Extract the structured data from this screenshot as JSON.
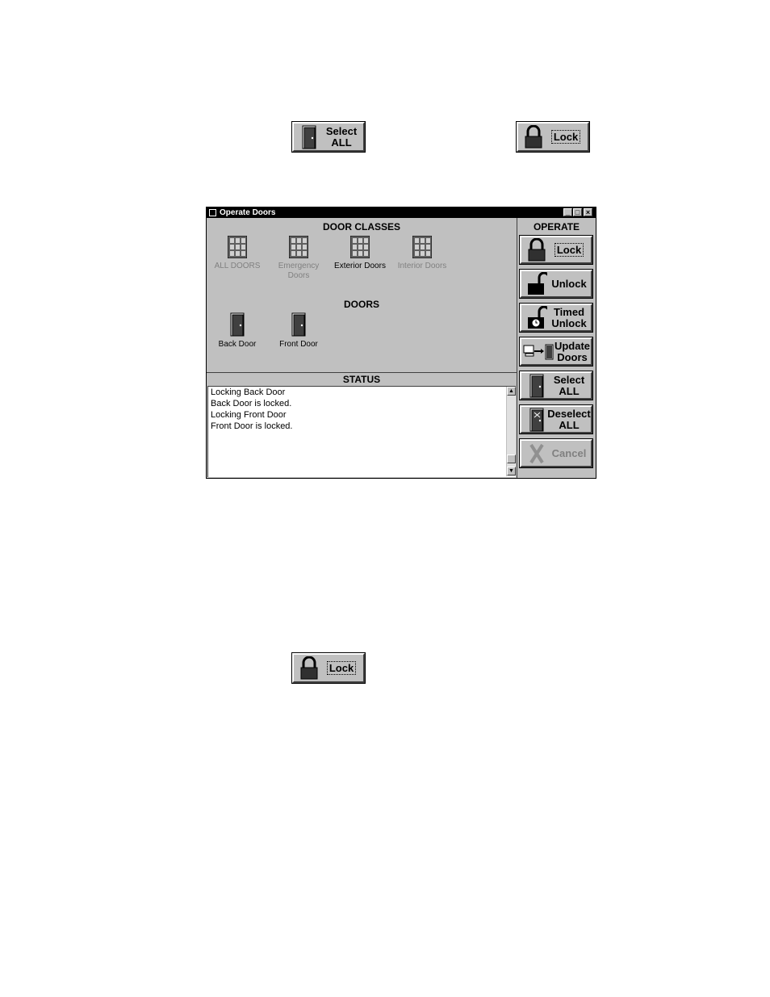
{
  "top_buttons": {
    "select_all": "Select\nALL",
    "lock": "Lock"
  },
  "window": {
    "title": "Operate Doors",
    "controls": {
      "minimize": "_",
      "maximize": "□",
      "close": "×"
    },
    "door_classes": {
      "heading": "DOOR CLASSES",
      "items": [
        {
          "label": "ALL DOORS",
          "dim": true
        },
        {
          "label": "Emergency\nDoors",
          "dim": true
        },
        {
          "label": "Exterior Doors",
          "dim": false
        },
        {
          "label": "Interior Doors",
          "dim": true
        }
      ]
    },
    "doors": {
      "heading": "DOORS",
      "items": [
        {
          "label": "Back Door"
        },
        {
          "label": "Front Door"
        }
      ]
    },
    "status": {
      "heading": "STATUS",
      "lines": [
        "Locking Back Door",
        "Back Door is locked.",
        "Locking Front Door",
        "Front Door is locked."
      ]
    },
    "operate": {
      "heading": "OPERATE",
      "buttons": {
        "lock": "Lock",
        "unlock": "Unlock",
        "timed_unlock": "Timed\nUnlock",
        "update_doors": "Update\nDoors",
        "select_all": "Select\nALL",
        "deselect_all": "Deselect\nALL",
        "cancel": "Cancel"
      }
    }
  },
  "bottom_buttons": {
    "lock": "Lock"
  }
}
